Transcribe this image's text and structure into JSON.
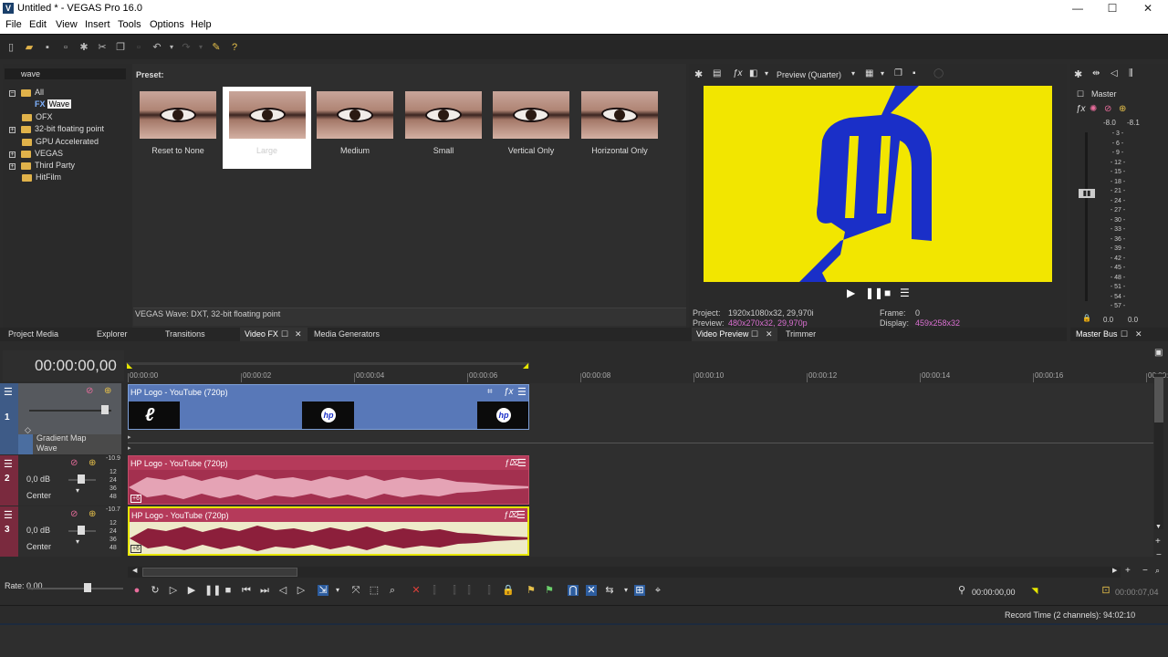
{
  "window": {
    "title": "Untitled * - VEGAS Pro 16.0",
    "logo": "V"
  },
  "menu": [
    "File",
    "Edit",
    "View",
    "Insert",
    "Tools",
    "Options",
    "Help"
  ],
  "window_buttons": {
    "minimize": "—",
    "maximize": "☐",
    "close": "✕"
  },
  "search": {
    "value": "wave"
  },
  "tree": {
    "items": [
      {
        "label": "All",
        "expander": "−"
      },
      {
        "label": "FX",
        "badge": "Wave"
      },
      {
        "label": "OFX"
      },
      {
        "label": "32-bit floating point",
        "expander": "+"
      },
      {
        "label": "GPU Accelerated"
      },
      {
        "label": "VEGAS",
        "expander": "+"
      },
      {
        "label": "Third Party",
        "expander": "+"
      },
      {
        "label": "HitFilm"
      }
    ]
  },
  "presets": {
    "label": "Preset:",
    "items": [
      "Reset to None",
      "Large",
      "Medium",
      "Small",
      "Vertical Only",
      "Horizontal Only"
    ],
    "selected": "Large"
  },
  "fx_status": "VEGAS Wave: DXT, 32-bit floating point",
  "tabs_left": [
    "Project Media",
    "Explorer",
    "Transitions",
    "Video FX",
    "Media Generators"
  ],
  "preview": {
    "mode": "Preview (Quarter)",
    "project_label": "Project:",
    "project_value": "1920x1080x32, 29,970i",
    "preview_label": "Preview:",
    "preview_value": "480x270x32, 29,970p",
    "frame_label": "Frame:",
    "frame_value": "0",
    "display_label": "Display:",
    "display_value": "459x258x32"
  },
  "tabs_preview": [
    "Video Preview",
    "Trimmer"
  ],
  "master": {
    "label": "Master",
    "peak_left": "-8.0",
    "peak_right": "-8.1",
    "scale": [
      "3",
      "6",
      "9",
      "12",
      "15",
      "18",
      "21",
      "24",
      "27",
      "30",
      "33",
      "36",
      "39",
      "42",
      "45",
      "48",
      "51",
      "54",
      "57"
    ],
    "level_left": "0.0",
    "level_right": "0.0",
    "tab": "Master Bus"
  },
  "timecode": "00:00:00,00",
  "ruler": [
    "00:00:00",
    "00:00:02",
    "00:00:04",
    "00:00:06",
    "00:00:08",
    "00:00:10",
    "00:00:12",
    "00:00:14",
    "00:00:16",
    "00:00:"
  ],
  "tracks": [
    {
      "number": "1",
      "kind": "video",
      "fx_list": [
        "Gradient Map",
        "Wave"
      ],
      "clip_title": "HP Logo - YouTube (720p)",
      "color": "#4f72b8"
    },
    {
      "number": "2",
      "kind": "audio",
      "peak": "-10.9",
      "volume": "0,0 dB",
      "pan": "Center",
      "scale": [
        "12",
        "24",
        "36",
        "48"
      ],
      "clip_title": "HP Logo - YouTube (720p)",
      "color": "#a3304f"
    },
    {
      "number": "3",
      "kind": "audio",
      "peak": "-10.7",
      "volume": "0,0 dB",
      "pan": "Center",
      "scale": [
        "12",
        "24",
        "36",
        "48"
      ],
      "clip_title": "HP Logo - YouTube (720p)",
      "color": "#a3304f"
    }
  ],
  "rate": "Rate: 0,00",
  "transport": {
    "cursor_time": "00:00:00,00",
    "end_time": "00:00:07,04"
  },
  "status": {
    "record_time": "Record Time (2 channels): 94:02:10"
  },
  "colors": {
    "accent": "#5a8fd8",
    "audio_clip": "#a3304f",
    "video_clip": "#4f72b8",
    "preview_bg": "#f2e600",
    "logo_blue": "#1a2fc8"
  }
}
